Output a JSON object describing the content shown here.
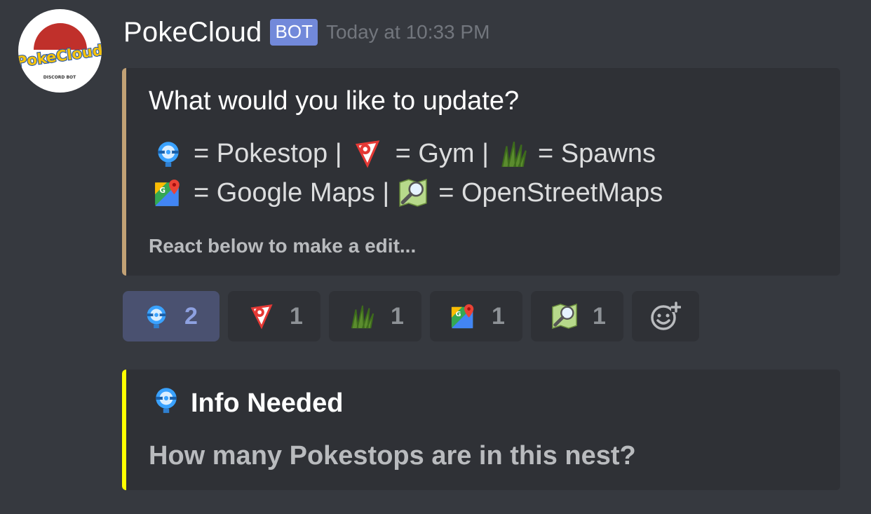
{
  "message": {
    "username": "PokeCloud",
    "bot_tag": "BOT",
    "timestamp": "Today at 10:33 PM",
    "avatar": {
      "logo_text": "PokeCloud",
      "sub_text": "DISCORD BOT"
    }
  },
  "embed_main": {
    "accent_color": "#c2a175",
    "title": "What would you like to update?",
    "legend_line1": [
      {
        "icon": "pokestop-icon",
        "text": "= Pokestop |"
      },
      {
        "icon": "gym-icon",
        "text": "= Gym |"
      },
      {
        "icon": "grass-icon",
        "text": "= Spawns"
      }
    ],
    "legend_line2": [
      {
        "icon": "google-maps-icon",
        "text": "= Google Maps |"
      },
      {
        "icon": "map-magnifier-icon",
        "text": "= OpenStreetMaps"
      }
    ],
    "footer": "React below to make a edit..."
  },
  "reactions": [
    {
      "icon": "pokestop-icon",
      "count": "2",
      "active": true
    },
    {
      "icon": "gym-icon",
      "count": "1",
      "active": false
    },
    {
      "icon": "grass-icon",
      "count": "1",
      "active": false
    },
    {
      "icon": "google-maps-icon",
      "count": "1",
      "active": false
    },
    {
      "icon": "map-magnifier-icon",
      "count": "1",
      "active": false
    }
  ],
  "add_reaction_icon": "add-reaction-icon",
  "embed_info": {
    "accent_color": "#ffff00",
    "title_icon": "pokestop-icon",
    "title": "Info Needed",
    "description": "How many Pokestops are in this nest?"
  }
}
